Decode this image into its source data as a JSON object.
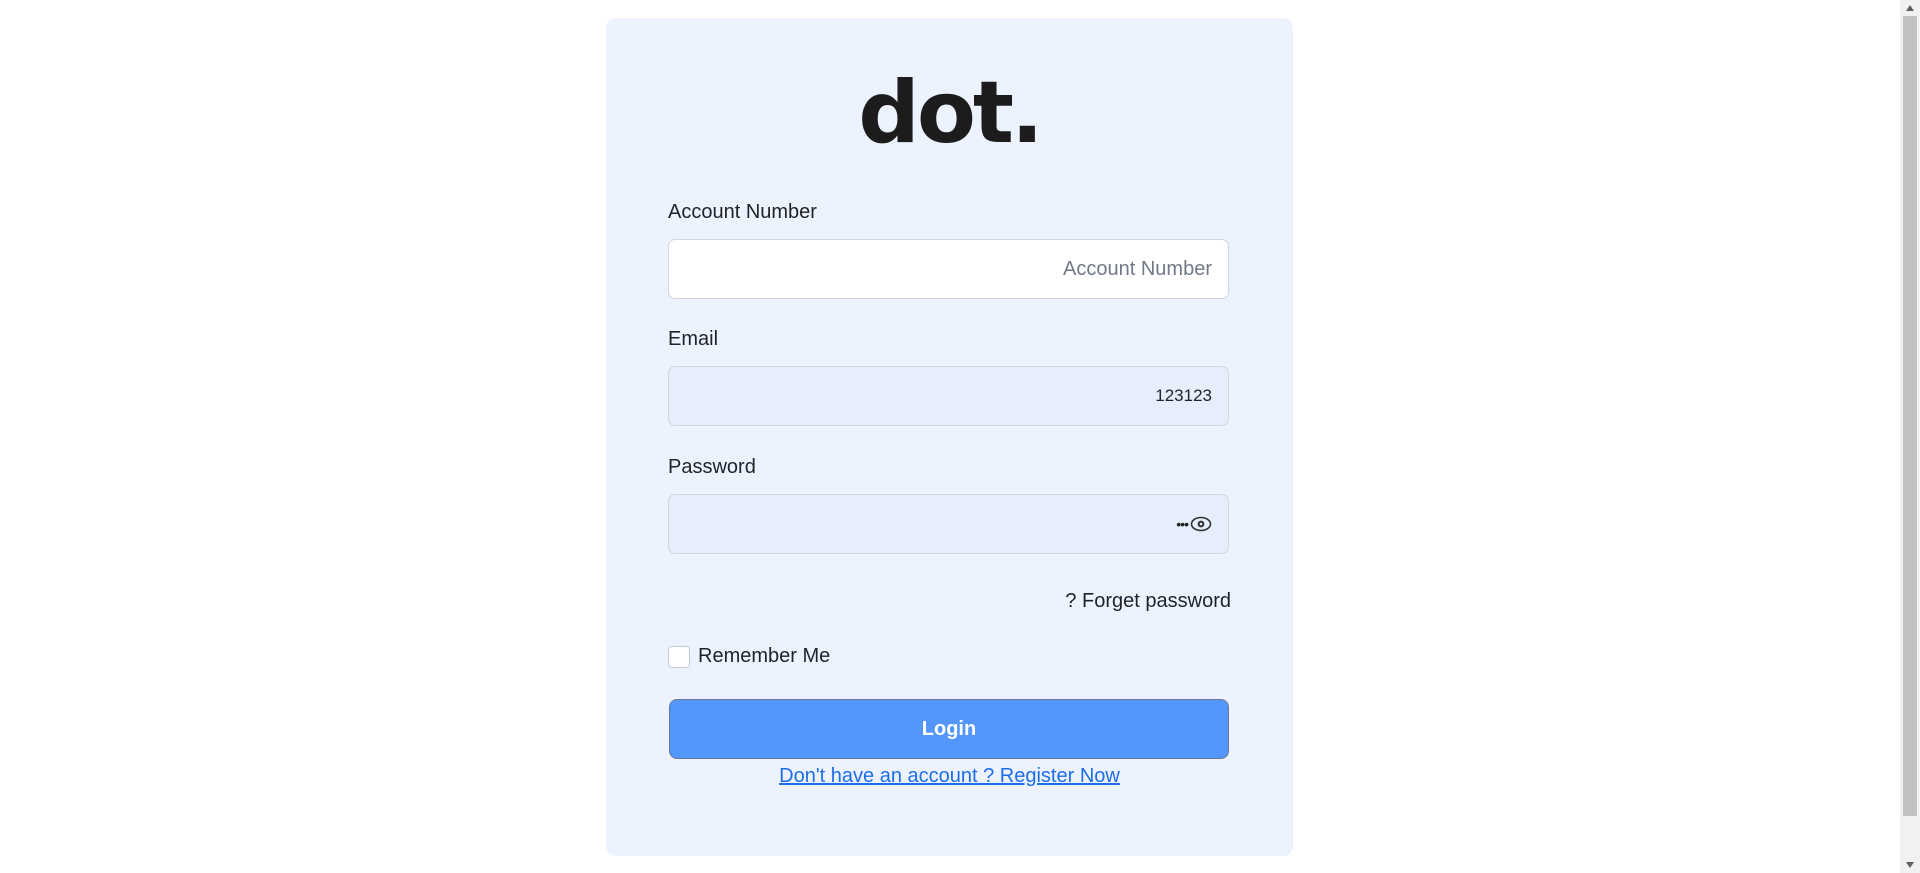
{
  "logo_text": "dot.",
  "account_number": {
    "label": "Account Number",
    "placeholder": "Account Number",
    "value": ""
  },
  "email": {
    "label": "Email",
    "value": "123123"
  },
  "password": {
    "label": "Password",
    "masked_value": "•••",
    "visibility_icon": "eye-icon"
  },
  "forgot_password": "? Forget password",
  "remember_me": {
    "label": "Remember Me",
    "checked": false
  },
  "login_button": "Login",
  "register_link": "Don't have an account ? Register Now",
  "colors": {
    "card_background": "#edf3fe",
    "login_button": "#5397fc",
    "link": "#1d6ee8",
    "filled_field": "#e6eefb"
  }
}
